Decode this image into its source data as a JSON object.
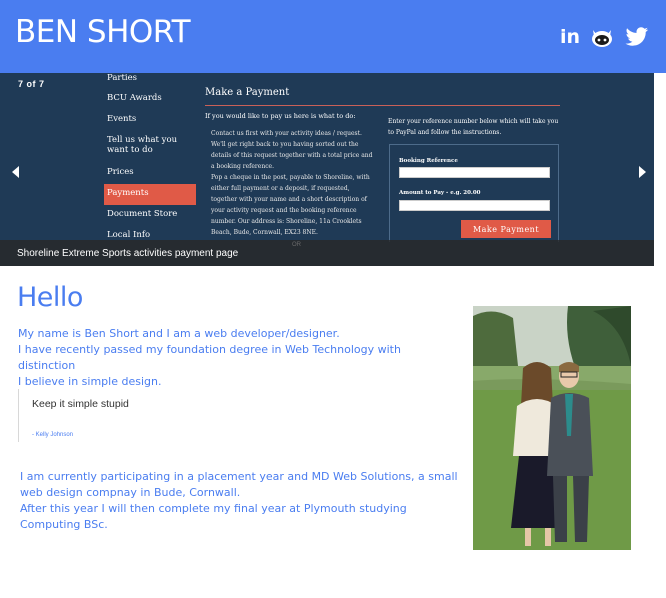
{
  "header": {
    "brand": "BEN SHORT",
    "social": {
      "linkedin_label": "in",
      "github_icon": "github-octocat-icon",
      "twitter_icon": "twitter-bird-icon"
    }
  },
  "carousel": {
    "counter": "7 of 7",
    "caption": "Shoreline Extreme Sports activities payment page",
    "screenshot": {
      "nav_items": [
        "Parties",
        "BCU Awards",
        "Events",
        "Tell us what you want to do",
        "Prices",
        "Payments",
        "Document Store",
        "Local Info"
      ],
      "active_item": "Payments",
      "page_title": "Make a Payment",
      "intro": "If you would like to pay us here is what to do:",
      "steps": [
        "Contact us first with your activity ideas / request.",
        "We'll get right back to you having sorted out the details of this request together with a total price and a booking reference.",
        "Pop a cheque in the post, payable to Shoreline, with either full payment or a deposit, if requested, together with your name and a short description of your activity request and the booking reference number. Our address is: Shoreline, 11a Crooklets Beach, Bude, Cornwall, EX23 8NE."
      ],
      "right_text": "Enter your reference number below which will take you to PayPal and follow the instructions.",
      "booking_label": "Booking Reference",
      "amount_label": "Amount to Pay - e.g. 20.00",
      "button_label": "Make Payment",
      "ghost_text": "OR"
    },
    "colors": {
      "slide_bg": "#1f3a56",
      "accent": "#e05a47"
    }
  },
  "main": {
    "heading": "Hello",
    "intro_lines": [
      "My name is Ben Short and I am a web developer/designer.",
      "I have recently passed my foundation degree in Web Technology with distinction",
      "I believe in simple design."
    ],
    "quote": {
      "text": "Keep it simple stupid",
      "author": "- Kelly Johnson"
    },
    "outro": {
      "prefix": "I am currently participating in a placement year and ",
      "link_text": "MD Web Solutions",
      "suffix": ", a small web design compnay in Bude, Cornwall.",
      "line2": "After this year I will then complete my final year at Plymouth studying Computing BSc."
    }
  },
  "colors": {
    "brand_blue": "#4a7df0"
  }
}
